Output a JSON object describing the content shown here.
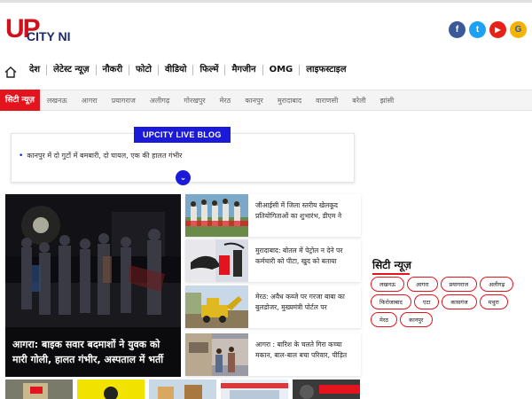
{
  "header": {
    "logo_mark": "UP",
    "logo_text": "CITY NI",
    "social": [
      {
        "name": "facebook",
        "glyph": "f",
        "color": "#3b5998"
      },
      {
        "name": "twitter",
        "glyph": "t",
        "color": "#1da1f2"
      },
      {
        "name": "youtube",
        "glyph": "▶",
        "color": "#e62117"
      },
      {
        "name": "google-news",
        "glyph": "G",
        "color": "#f4b400"
      }
    ]
  },
  "nav": {
    "items": [
      "देश",
      "लेटेस्ट न्यूज़",
      "नौकरी",
      "फोटो",
      "वीडियो",
      "फिल्में",
      "मैगजीन",
      "OMG",
      "लाइफस्टाइल"
    ]
  },
  "citybar": {
    "active": "सिटी न्यूज़",
    "items": [
      "लखनऊ",
      "आगरा",
      "प्रयागराज",
      "अलीगढ़",
      "गोरखपुर",
      "मेरठ",
      "कानपुर",
      "मुरादाबाद",
      "वाराणसी",
      "बरेली",
      "झांसी"
    ]
  },
  "liveblog": {
    "title": "UPCITY LIVE BLOG",
    "item": "कानपुर में दो गुटों में बमबारी, दो घायल, एक की हालत गंभीर",
    "more_glyph": "⌄"
  },
  "hero": {
    "caption": "आगरा: बाइक सवार बदमाशों ने युवक को मारी गोली, हालत गंभीर, अस्पताल में भर्ती"
  },
  "stories": [
    {
      "text": "जीआईसी में जिला स्तरीय खेलकूद प्रतियोगिताओं का शुभारंभ, डीएम ने"
    },
    {
      "text": "मुरादाबाद: बोतल में पेट्रोल न देने पर कर्मचारी को पीटा, खुद को बताया"
    },
    {
      "text": "मेरठ: अवैध कब्जे पर गरजा बाबा का बुलडोजर, मुख्यमंत्री पोर्टल पर"
    },
    {
      "text": "आगरा : बारिश के चलते गिरा कच्चा मकान, बाल-बाल बचा परिवार, पीड़ित"
    }
  ],
  "city_news": {
    "title": "सिटी न्यूज़",
    "tags": [
      "लखनऊ",
      "आगरा",
      "प्रयागराज",
      "अलीगढ़",
      "फिरोजाबाद",
      "एटा",
      "कासगंज",
      "मथुरा",
      "मेरठ",
      "कानपुर"
    ]
  },
  "colors": {
    "brand_red": "#e3141d",
    "live_blue": "#1a1ad8",
    "logo_navy": "#1a2a6c"
  }
}
